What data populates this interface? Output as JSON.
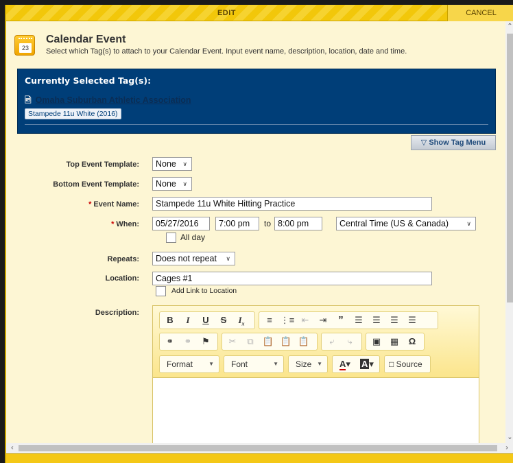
{
  "topbar": {
    "edit_label": "EDIT",
    "cancel_label": "CANCEL"
  },
  "header": {
    "icon_day": "23",
    "title": "Calendar Event",
    "subtitle": "Select which Tag(s) to attach to your Calendar Event. Input event name, description, location, date and time."
  },
  "tags": {
    "title": "Currently Selected Tag(s):",
    "org_name": "Omaha Suburban Athletic Association",
    "chip": "Stampede 11u White (2016)",
    "show_menu_label": "Show Tag Menu"
  },
  "form": {
    "top_template_label": "Top Event Template:",
    "top_template_value": "None",
    "bottom_template_label": "Bottom Event Template:",
    "bottom_template_value": "None",
    "event_name_label": "Event Name:",
    "event_name_value": "Stampede 11u White Hitting Practice",
    "when_label": "When:",
    "date_value": "05/27/2016",
    "start_time": "7:00 pm",
    "to_label": "to",
    "end_time": "8:00 pm",
    "timezone": "Central Time (US & Canada)",
    "all_day_label": "All day",
    "repeats_label": "Repeats:",
    "repeats_value": "Does not repeat",
    "location_label": "Location:",
    "location_value": "Cages #1",
    "add_link_label": "Add Link to Location",
    "description_label": "Description:",
    "required_mark": "*"
  },
  "editor": {
    "format_label": "Format",
    "font_label": "Font",
    "size_label": "Size",
    "source_label": "Source"
  }
}
